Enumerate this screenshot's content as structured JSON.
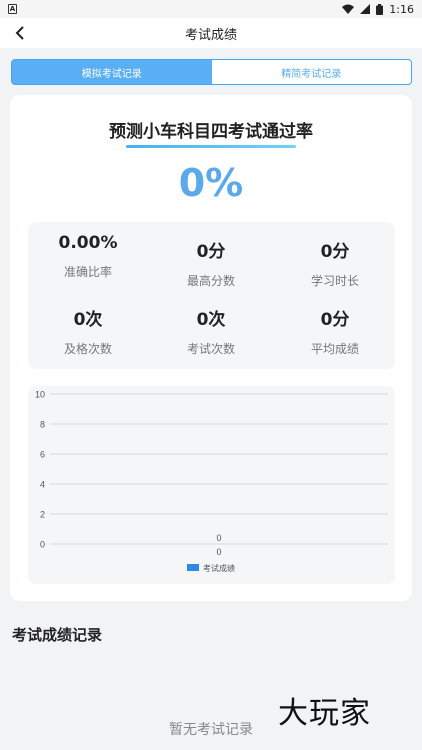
{
  "status_bar": {
    "app_icon_letter": "A",
    "time": "1:16"
  },
  "nav": {
    "title": "考试成绩"
  },
  "tabs": [
    {
      "label": "模拟考试记录",
      "active": true
    },
    {
      "label": "精简考试记录",
      "active": false
    }
  ],
  "summary": {
    "headline": "预测小车科目四考试通过率",
    "pass_rate": "0%"
  },
  "stats": [
    {
      "value": "0.00%",
      "label": "准确比率"
    },
    {
      "value": "0分",
      "label": "最高分数"
    },
    {
      "value": "0分",
      "label": "学习时长"
    },
    {
      "value": "0次",
      "label": "及格次数"
    },
    {
      "value": "0次",
      "label": "考试次数"
    },
    {
      "value": "0分",
      "label": "平均成绩"
    }
  ],
  "chart_data": {
    "type": "bar",
    "categories": [
      "0"
    ],
    "series": [
      {
        "name": "考试成绩",
        "values": [
          0
        ]
      }
    ],
    "y_ticks": [
      "0",
      "2",
      "4",
      "6",
      "8",
      "10"
    ],
    "ylim": [
      0,
      10
    ],
    "grid": true,
    "legend": "bottom",
    "color": "#2f8ae6"
  },
  "records": {
    "title": "考试成绩记录",
    "empty_text": "暂无考试记录"
  },
  "watermark": "大玩家"
}
